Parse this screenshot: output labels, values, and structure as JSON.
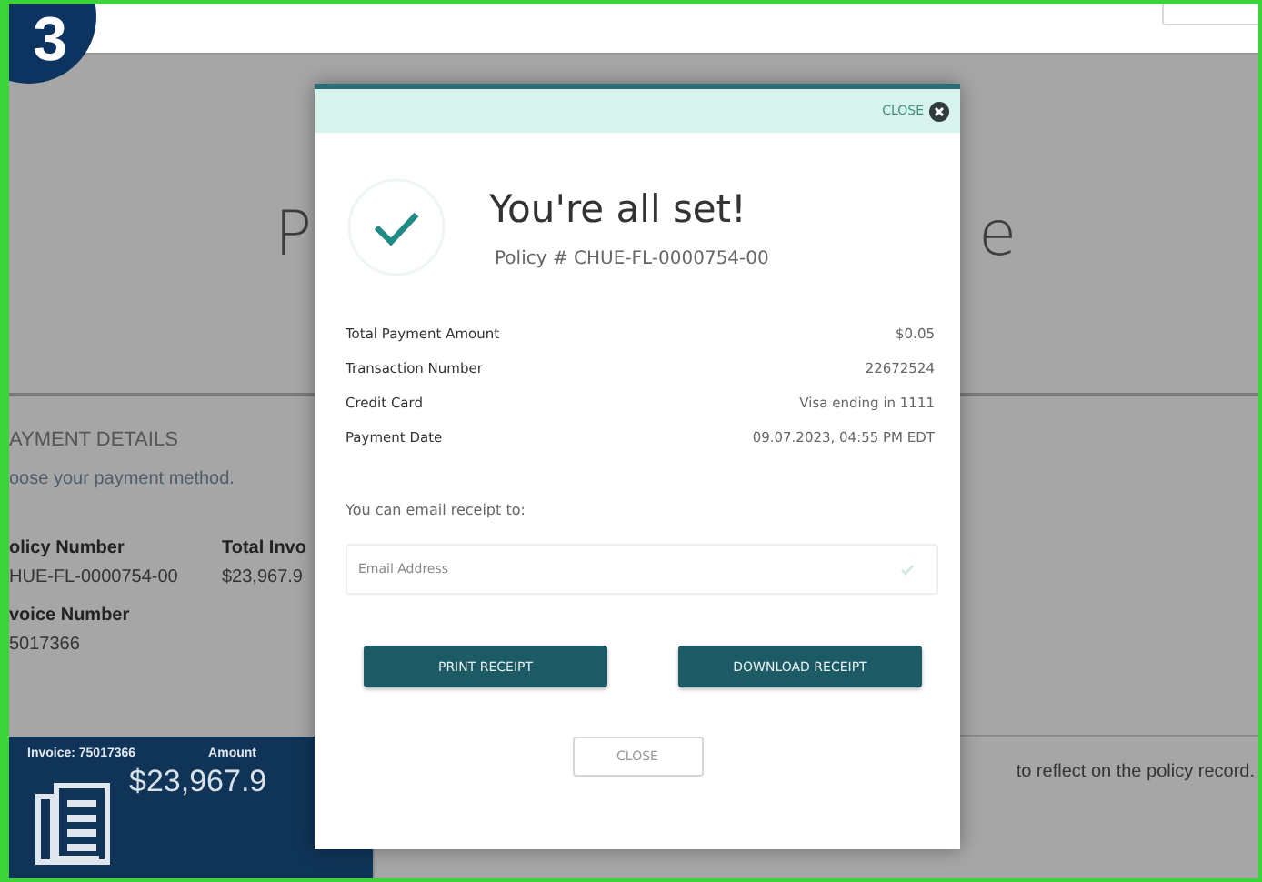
{
  "step_badge": "3",
  "page": {
    "title_fragments": [
      "P",
      "e"
    ],
    "section_title": "AYMENT DETAILS",
    "section_hint": "oose your payment method.",
    "fields": [
      {
        "label": "olicy Number",
        "value": "HUE-FL-0000754-00"
      },
      {
        "label": "Total Invo",
        "value": "$23,967.9"
      },
      {
        "label": "voice Number",
        "value": "5017366"
      }
    ],
    "invoice_card": {
      "invoice": "Invoice: 75017366",
      "amount_label": "Amount",
      "amount": "$23,967.9"
    },
    "note": "to reflect on the policy record."
  },
  "modal": {
    "close_link": "CLOSE",
    "title": "You're all set!",
    "subtitle": "Policy # CHUE-FL-0000754-00",
    "details": [
      {
        "label": "Total Payment Amount",
        "value": "$0.05"
      },
      {
        "label": "Transaction Number",
        "value": "22672524"
      },
      {
        "label": "Credit Card",
        "value": "Visa ending in 1111"
      },
      {
        "label": "Payment Date",
        "value": "09.07.2023, 04:55 PM EDT"
      }
    ],
    "email_label": "You can email receipt to:",
    "email": {
      "placeholder": "Email Address"
    },
    "buttons": [
      {
        "label": "PRINT RECEIPT",
        "kind": "primary"
      },
      {
        "label": "DOWNLOAD RECEIPT",
        "kind": "primary"
      },
      {
        "label": "CLOSE",
        "kind": "secondary"
      }
    ]
  }
}
